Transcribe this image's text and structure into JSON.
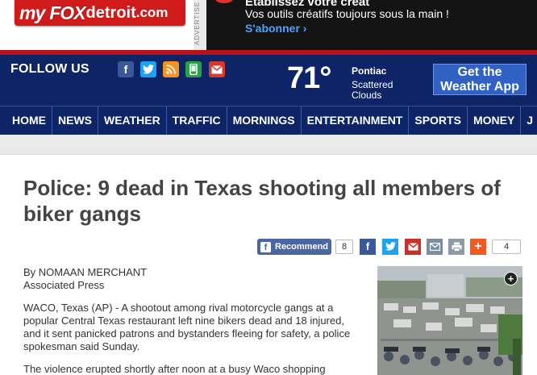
{
  "header": {
    "logo": {
      "my": "my",
      "fox": "FOX",
      "detroit": "detroit",
      "dotcom": ".com"
    },
    "ad_label": "ADVERTISE",
    "ad": {
      "line1": "Établissez votre créat",
      "line2": "Vos outils créatifs toujours sous la main !",
      "cta": "S'abonner ›"
    }
  },
  "follow": {
    "label": "FOLLOW US",
    "icons": [
      "facebook-icon",
      "twitter-icon",
      "rss-icon",
      "mobile-icon",
      "email-icon"
    ]
  },
  "weather": {
    "temp": "71°",
    "city": "Pontiac",
    "conditions": "Scattered Clouds",
    "app_button": "Get the Weather App"
  },
  "nav": {
    "items": [
      "HOME",
      "NEWS",
      "WEATHER",
      "TRAFFIC",
      "MORNINGS",
      "ENTERTAINMENT",
      "SPORTS",
      "MONEY",
      "J"
    ]
  },
  "article": {
    "headline": "Police: 9 dead in Texas shooting all members of biker gangs",
    "share": {
      "recommend_label": "Recommend",
      "recommend_count": "8",
      "share_count": "4"
    },
    "byline_author": "By NOMAAN MERCHANT",
    "byline_source": "Associated Press",
    "paragraph1": "WACO, Texas (AP) - A shootout among rival motorcycle gangs at a popular Central Texas restaurant left nine bikers dead and 18 injured, and it sent panicked patrons and bystanders fleeing for safety, a police spokesman said Sunday.",
    "paragraph2": "The violence erupted shortly after noon at a busy Waco shopping"
  },
  "colors": {
    "brand_red": "#d11a1a",
    "nav_blue": "#0d2466",
    "rule_red": "#b8121b"
  }
}
